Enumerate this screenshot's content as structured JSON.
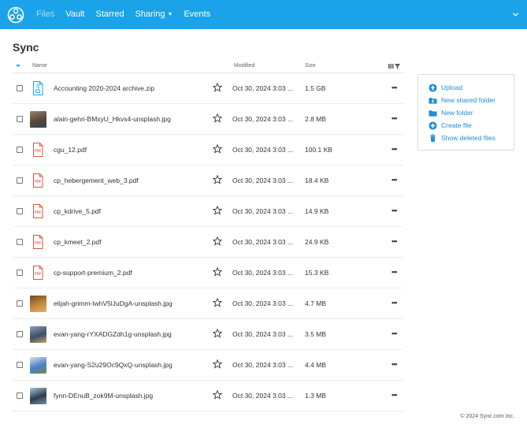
{
  "app": {
    "brand_color": "#1aa3e8",
    "link_color": "#1f8fd6",
    "pdf_color": "#e2533c"
  },
  "nav": {
    "items": [
      {
        "label": "Files",
        "active": true
      },
      {
        "label": "Vault",
        "active": false
      },
      {
        "label": "Starred",
        "active": false
      },
      {
        "label": "Sharing",
        "active": false,
        "dropdown": true
      },
      {
        "label": "Events",
        "active": false
      }
    ]
  },
  "page": {
    "title": "Sync"
  },
  "table": {
    "headers": {
      "name": "Name",
      "modified": "Modified",
      "size": "Size"
    },
    "rows": [
      {
        "icon": "zip-file-icon",
        "name": "Accounting 2020-2024 archive.zip",
        "modified": "Oct 30, 2024 3:03 ...",
        "size": "1.5 GB"
      },
      {
        "icon": "image-thumbnail",
        "name": "alain-gehri-BMxyU_Hkvs4-unsplash.jpg",
        "modified": "Oct 30, 2024 3:03 ...",
        "size": "2.8 MB"
      },
      {
        "icon": "pdf-file-icon",
        "name": "cgu_12.pdf",
        "modified": "Oct 30, 2024 3:03 ...",
        "size": "100.1 KB"
      },
      {
        "icon": "pdf-file-icon",
        "name": "cp_hebergement_web_3.pdf",
        "modified": "Oct 30, 2024 3:03 ...",
        "size": "18.4 KB"
      },
      {
        "icon": "pdf-file-icon",
        "name": "cp_kdrive_5.pdf",
        "modified": "Oct 30, 2024 3:03 ...",
        "size": "14.9 KB"
      },
      {
        "icon": "pdf-file-icon",
        "name": "cp_kmeet_2.pdf",
        "modified": "Oct 30, 2024 3:03 ...",
        "size": "24.9 KB"
      },
      {
        "icon": "pdf-file-icon",
        "name": "cp-support-premium_2.pdf",
        "modified": "Oct 30, 2024 3:03 ...",
        "size": "15.3 KB"
      },
      {
        "icon": "image-thumbnail",
        "name": "elijah-grimm-IwhV5lJuDgA-unsplash.jpg",
        "modified": "Oct 30, 2024 3:03 ...",
        "size": "4.7 MB"
      },
      {
        "icon": "image-thumbnail",
        "name": "evan-yang-rYXADGZdh1g-unsplash.jpg",
        "modified": "Oct 30, 2024 3:03 ...",
        "size": "3.5 MB"
      },
      {
        "icon": "image-thumbnail",
        "name": "evan-yang-S2u29Oc9QxQ-unsplash.jpg",
        "modified": "Oct 30, 2024 3:03 ...",
        "size": "4.4 MB"
      },
      {
        "icon": "image-thumbnail",
        "name": "fynn-DEnuB_zok9M-unsplash.jpg",
        "modified": "Oct 30, 2024 3:03 ...",
        "size": "1.3 MB"
      }
    ]
  },
  "actions": [
    {
      "icon": "upload-cloud-icon",
      "label": "Upload"
    },
    {
      "icon": "shared-folder-icon",
      "label": "New shared folder"
    },
    {
      "icon": "folder-icon",
      "label": "New folder"
    },
    {
      "icon": "create-file-icon",
      "label": "Create file"
    },
    {
      "icon": "trash-icon",
      "label": "Show deleted files"
    }
  ],
  "footer": {
    "copyright": "© 2024 Sync.com Inc."
  }
}
